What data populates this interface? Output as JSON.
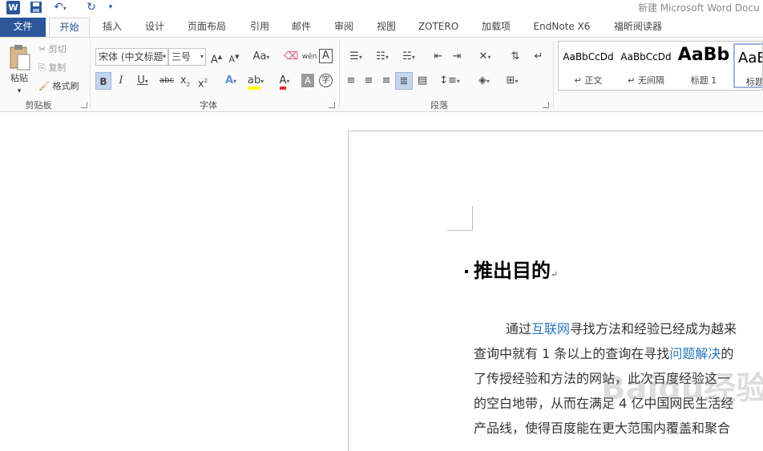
{
  "app": {
    "title": "新建 Microsoft Word Docu",
    "logo": "W"
  },
  "qat": {
    "save_icon": "save-icon",
    "undo_icon": "undo-icon",
    "redo_icon": "redo-icon",
    "customize_icon": "customize-icon"
  },
  "tabs": {
    "file": "文件",
    "home": "开始",
    "insert": "插入",
    "design": "设计",
    "layout": "页面布局",
    "references": "引用",
    "mailings": "邮件",
    "review": "审阅",
    "view": "视图",
    "zotero": "ZOTERO",
    "addins": "加载项",
    "endnote": "EndNote X6",
    "foxit": "福昕阅读器"
  },
  "clipboard": {
    "paste": "粘贴",
    "cut": "剪切",
    "copy": "复制",
    "format_painter": "格式刷",
    "label": "剪贴板"
  },
  "font": {
    "name": "宋体 (中文标题",
    "size": "三号",
    "label": "字体",
    "grow": "A",
    "shrink": "A",
    "case": "Aa",
    "bold": "B",
    "italic": "I",
    "underline": "U",
    "strike": "abc",
    "sub": "x",
    "sup": "x",
    "text_effect": "A",
    "font_color": "A",
    "shading": "A",
    "phonetic": "wén",
    "border_char": "A",
    "enclose": "字"
  },
  "paragraph": {
    "label": "段落"
  },
  "styles": {
    "items": [
      {
        "sample": "AaBbCcDd",
        "name": "↵ 正文"
      },
      {
        "sample": "AaBbCcDd",
        "name": "↵ 无间隔"
      },
      {
        "sample": "AaBb",
        "name": "标题 1"
      },
      {
        "sample": "AaB",
        "name": "标题"
      }
    ]
  },
  "document": {
    "heading": "推出目的",
    "paragraph_mark": "↵",
    "lines": [
      {
        "pre": "通过",
        "link": "互联网",
        "post": "寻找方法和经验已经成为越来"
      },
      {
        "pre": "查询中就有 1 条以上的查询在寻找",
        "link": "问题解决",
        "post": "的"
      },
      {
        "pre": "了传授经验和方法的网站，此次百度经验这一",
        "link": "",
        "post": ""
      },
      {
        "pre": "的空白地带，从而在满足 4 亿中国网民生活经",
        "link": "",
        "post": ""
      },
      {
        "pre": "产品线，使得百度能在更大范围内覆盖和聚合",
        "link": "",
        "post": ""
      }
    ],
    "watermark": "Baidu经验"
  }
}
